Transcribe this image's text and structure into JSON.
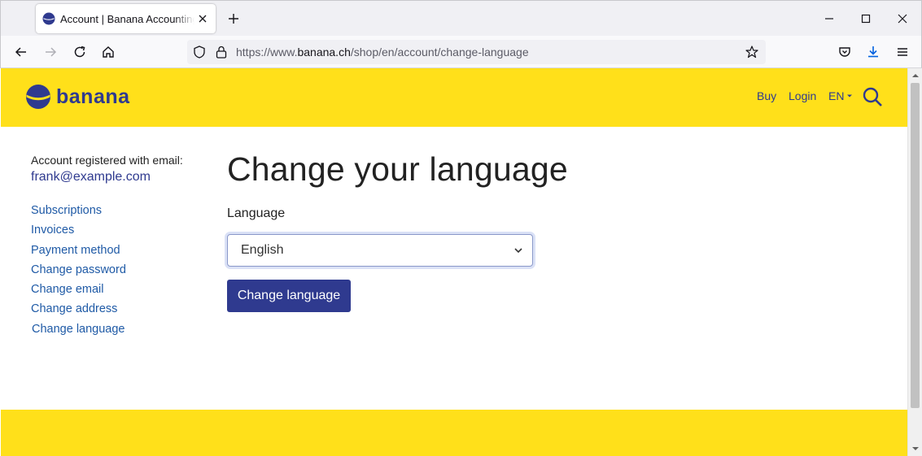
{
  "browser": {
    "tab_title": "Account | Banana Accounting Software",
    "url_prefix": "https://www.",
    "url_host": "banana.ch",
    "url_path": "/shop/en/account/change-language"
  },
  "header": {
    "logo_text": "banana",
    "nav": {
      "buy": "Buy",
      "login": "Login",
      "lang": "EN"
    }
  },
  "sidebar": {
    "account_label": "Account registered with email:",
    "email": "frank@example.com",
    "links": [
      "Subscriptions",
      "Invoices",
      "Payment method",
      "Change password",
      "Change email",
      "Change address",
      "Change language"
    ]
  },
  "main": {
    "title": "Change your language",
    "field_label": "Language",
    "selected_language": "English",
    "submit_label": "Change language"
  },
  "colors": {
    "brand_yellow": "#ffe01a",
    "brand_blue": "#2f3a8f",
    "link_blue": "#1f5aa6"
  }
}
